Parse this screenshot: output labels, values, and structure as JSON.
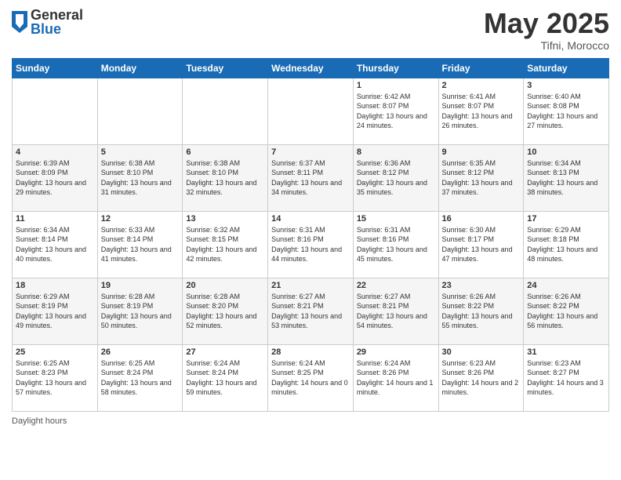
{
  "header": {
    "logo_general": "General",
    "logo_blue": "Blue",
    "title": "May 2025",
    "location": "Tifni, Morocco"
  },
  "days_of_week": [
    "Sunday",
    "Monday",
    "Tuesday",
    "Wednesday",
    "Thursday",
    "Friday",
    "Saturday"
  ],
  "weeks": [
    [
      {
        "day": "",
        "info": ""
      },
      {
        "day": "",
        "info": ""
      },
      {
        "day": "",
        "info": ""
      },
      {
        "day": "",
        "info": ""
      },
      {
        "day": "1",
        "info": "Sunrise: 6:42 AM\nSunset: 8:07 PM\nDaylight: 13 hours and 24 minutes."
      },
      {
        "day": "2",
        "info": "Sunrise: 6:41 AM\nSunset: 8:07 PM\nDaylight: 13 hours and 26 minutes."
      },
      {
        "day": "3",
        "info": "Sunrise: 6:40 AM\nSunset: 8:08 PM\nDaylight: 13 hours and 27 minutes."
      }
    ],
    [
      {
        "day": "4",
        "info": "Sunrise: 6:39 AM\nSunset: 8:09 PM\nDaylight: 13 hours and 29 minutes."
      },
      {
        "day": "5",
        "info": "Sunrise: 6:38 AM\nSunset: 8:10 PM\nDaylight: 13 hours and 31 minutes."
      },
      {
        "day": "6",
        "info": "Sunrise: 6:38 AM\nSunset: 8:10 PM\nDaylight: 13 hours and 32 minutes."
      },
      {
        "day": "7",
        "info": "Sunrise: 6:37 AM\nSunset: 8:11 PM\nDaylight: 13 hours and 34 minutes."
      },
      {
        "day": "8",
        "info": "Sunrise: 6:36 AM\nSunset: 8:12 PM\nDaylight: 13 hours and 35 minutes."
      },
      {
        "day": "9",
        "info": "Sunrise: 6:35 AM\nSunset: 8:12 PM\nDaylight: 13 hours and 37 minutes."
      },
      {
        "day": "10",
        "info": "Sunrise: 6:34 AM\nSunset: 8:13 PM\nDaylight: 13 hours and 38 minutes."
      }
    ],
    [
      {
        "day": "11",
        "info": "Sunrise: 6:34 AM\nSunset: 8:14 PM\nDaylight: 13 hours and 40 minutes."
      },
      {
        "day": "12",
        "info": "Sunrise: 6:33 AM\nSunset: 8:14 PM\nDaylight: 13 hours and 41 minutes."
      },
      {
        "day": "13",
        "info": "Sunrise: 6:32 AM\nSunset: 8:15 PM\nDaylight: 13 hours and 42 minutes."
      },
      {
        "day": "14",
        "info": "Sunrise: 6:31 AM\nSunset: 8:16 PM\nDaylight: 13 hours and 44 minutes."
      },
      {
        "day": "15",
        "info": "Sunrise: 6:31 AM\nSunset: 8:16 PM\nDaylight: 13 hours and 45 minutes."
      },
      {
        "day": "16",
        "info": "Sunrise: 6:30 AM\nSunset: 8:17 PM\nDaylight: 13 hours and 47 minutes."
      },
      {
        "day": "17",
        "info": "Sunrise: 6:29 AM\nSunset: 8:18 PM\nDaylight: 13 hours and 48 minutes."
      }
    ],
    [
      {
        "day": "18",
        "info": "Sunrise: 6:29 AM\nSunset: 8:19 PM\nDaylight: 13 hours and 49 minutes."
      },
      {
        "day": "19",
        "info": "Sunrise: 6:28 AM\nSunset: 8:19 PM\nDaylight: 13 hours and 50 minutes."
      },
      {
        "day": "20",
        "info": "Sunrise: 6:28 AM\nSunset: 8:20 PM\nDaylight: 13 hours and 52 minutes."
      },
      {
        "day": "21",
        "info": "Sunrise: 6:27 AM\nSunset: 8:21 PM\nDaylight: 13 hours and 53 minutes."
      },
      {
        "day": "22",
        "info": "Sunrise: 6:27 AM\nSunset: 8:21 PM\nDaylight: 13 hours and 54 minutes."
      },
      {
        "day": "23",
        "info": "Sunrise: 6:26 AM\nSunset: 8:22 PM\nDaylight: 13 hours and 55 minutes."
      },
      {
        "day": "24",
        "info": "Sunrise: 6:26 AM\nSunset: 8:22 PM\nDaylight: 13 hours and 56 minutes."
      }
    ],
    [
      {
        "day": "25",
        "info": "Sunrise: 6:25 AM\nSunset: 8:23 PM\nDaylight: 13 hours and 57 minutes."
      },
      {
        "day": "26",
        "info": "Sunrise: 6:25 AM\nSunset: 8:24 PM\nDaylight: 13 hours and 58 minutes."
      },
      {
        "day": "27",
        "info": "Sunrise: 6:24 AM\nSunset: 8:24 PM\nDaylight: 13 hours and 59 minutes."
      },
      {
        "day": "28",
        "info": "Sunrise: 6:24 AM\nSunset: 8:25 PM\nDaylight: 14 hours and 0 minutes."
      },
      {
        "day": "29",
        "info": "Sunrise: 6:24 AM\nSunset: 8:26 PM\nDaylight: 14 hours and 1 minute."
      },
      {
        "day": "30",
        "info": "Sunrise: 6:23 AM\nSunset: 8:26 PM\nDaylight: 14 hours and 2 minutes."
      },
      {
        "day": "31",
        "info": "Sunrise: 6:23 AM\nSunset: 8:27 PM\nDaylight: 14 hours and 3 minutes."
      }
    ]
  ],
  "footer": {
    "daylight_label": "Daylight hours"
  }
}
